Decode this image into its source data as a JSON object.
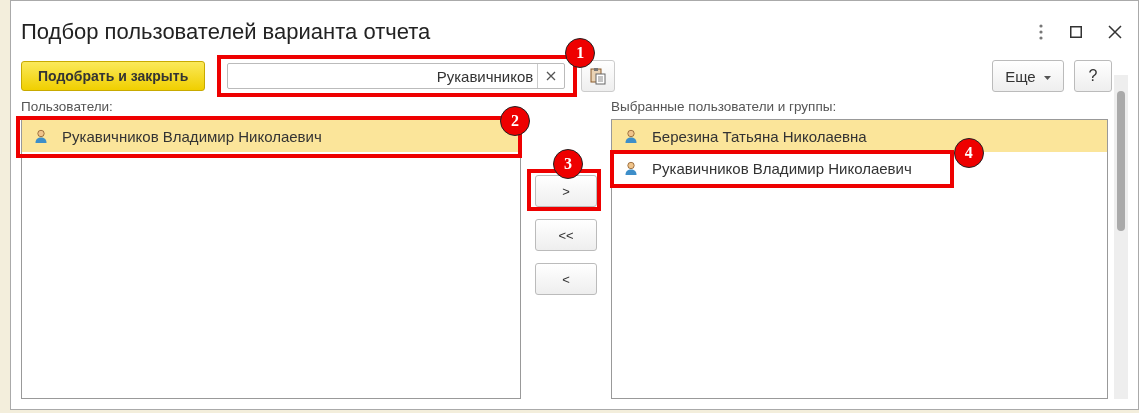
{
  "window": {
    "title": "Подбор пользователей варианта отчета"
  },
  "toolbar": {
    "pick_button": "Подобрать и закрыть",
    "search": {
      "value": "Рукавичников",
      "callout": "1"
    },
    "more_button": "Еще",
    "help_button": "?"
  },
  "users": {
    "label": "Пользователи:",
    "rows": [
      {
        "name": "Рукавичников Владимир Николаевич",
        "selected": true,
        "callout": "2"
      }
    ]
  },
  "move_buttons": [
    {
      "label": ">",
      "callout": "3"
    },
    {
      "label": "<<"
    },
    {
      "label": "<"
    }
  ],
  "selected_users": {
    "label": "Выбранные пользователи и группы:",
    "rows": [
      {
        "name": "Березина Татьяна Николаевна",
        "selected": true
      },
      {
        "name": "Рукавичников Владимир Николаевич",
        "selected": false,
        "callout": "4"
      }
    ]
  }
}
